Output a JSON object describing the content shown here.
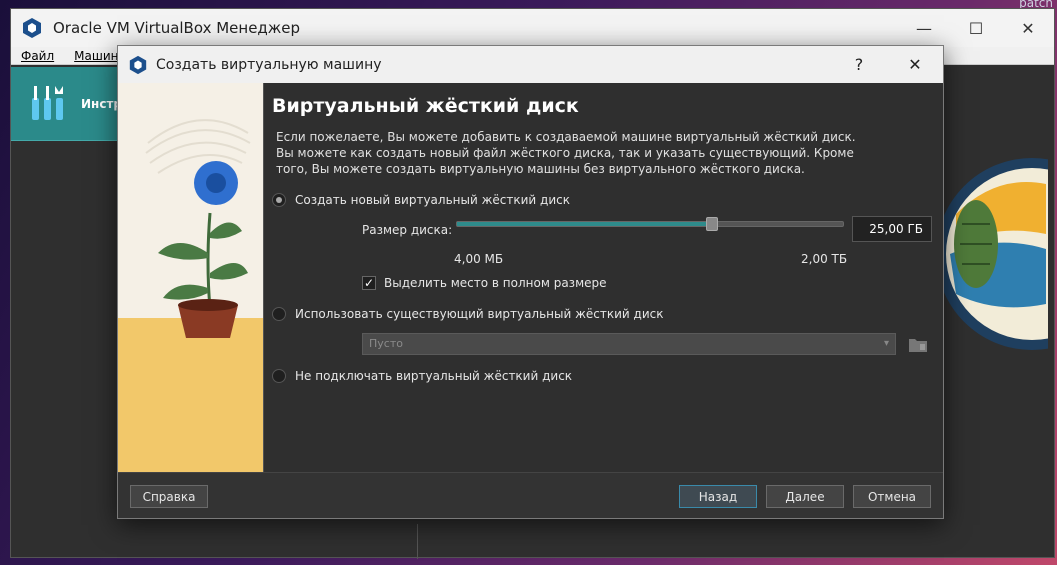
{
  "desktop": {
    "corner_text": "patch"
  },
  "main_window": {
    "title": "Oracle VM VirtualBox Менеджер",
    "menu": [
      "Файл",
      "Машина"
    ],
    "tools_label": "Инстр"
  },
  "dialog": {
    "title": "Создать виртуальную машину",
    "help_glyph": "?",
    "close_glyph": "✕",
    "heading": "Виртуальный жёсткий диск",
    "description": "Если пожелаете, Вы можете добавить к создаваемой машине виртуальный жёсткий диск. Вы можете как создать новый файл жёсткого диска, так и указать существующий. Кроме того, Вы можете создать виртуальную машины без виртуального жёсткого диска.",
    "options": {
      "create_new": {
        "label": "Создать новый виртуальный жёсткий диск",
        "selected": true
      },
      "use_existing": {
        "label": "Использовать существующий виртуальный жёсткий диск",
        "selected": false
      },
      "no_disk": {
        "label": "Не подключать виртуальный жёсткий диск",
        "selected": false
      }
    },
    "disk_size": {
      "label": "Размер диска:",
      "value_text": "25,00 ГБ",
      "min_label": "4,00 МБ",
      "max_label": "2,00 ТБ",
      "slider_fraction": 0.66
    },
    "preallocate": {
      "label": "Выделить место в полном размере",
      "checked": true,
      "check_glyph": "✓"
    },
    "existing_combo": {
      "value": "Пусто",
      "arrow": "▾"
    },
    "buttons": {
      "help": "Справка",
      "back": "Назад",
      "next": "Далее",
      "cancel": "Отмена"
    }
  }
}
